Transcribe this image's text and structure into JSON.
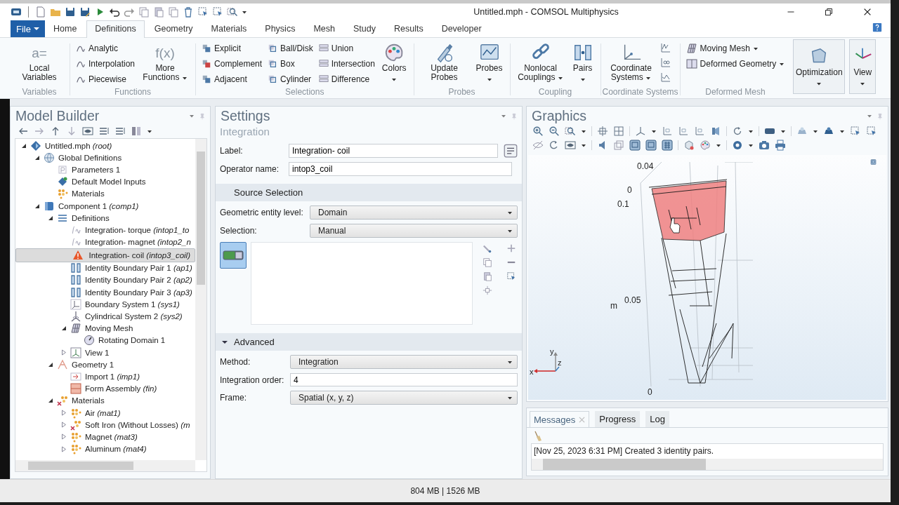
{
  "window": {
    "title": "Untitled.mph - COMSOL Multiphysics"
  },
  "file_button": {
    "label": "File"
  },
  "tabs": [
    {
      "label": "Home",
      "selected": false
    },
    {
      "label": "Definitions",
      "selected": true
    },
    {
      "label": "Geometry",
      "selected": false
    },
    {
      "label": "Materials",
      "selected": false
    },
    {
      "label": "Physics",
      "selected": false
    },
    {
      "label": "Mesh",
      "selected": false
    },
    {
      "label": "Study",
      "selected": false
    },
    {
      "label": "Results",
      "selected": false
    },
    {
      "label": "Developer",
      "selected": false
    }
  ],
  "ribbon": {
    "groups": [
      {
        "label": "Variables",
        "blocks": [
          {
            "kind": "large",
            "glyph": "a=",
            "label": "Local Variables"
          }
        ]
      },
      {
        "label": "Functions",
        "blocks": [
          {
            "kind": "stack",
            "items": [
              {
                "label": "Analytic"
              },
              {
                "label": "Interpolation"
              },
              {
                "label": "Piecewise"
              }
            ]
          },
          {
            "kind": "large",
            "glyph": "f(x)",
            "label": "More Functions",
            "dropdown": true
          }
        ]
      },
      {
        "label": "Selections",
        "blocks": [
          {
            "kind": "stack",
            "items": [
              {
                "label": "Explicit"
              },
              {
                "label": "Complement"
              },
              {
                "label": "Adjacent"
              }
            ]
          },
          {
            "kind": "stack",
            "items": [
              {
                "label": "Ball/Disk"
              },
              {
                "label": "Box"
              },
              {
                "label": "Cylinder"
              }
            ]
          },
          {
            "kind": "stack",
            "items": [
              {
                "label": "Union"
              },
              {
                "label": "Intersection"
              },
              {
                "label": "Difference"
              }
            ]
          },
          {
            "kind": "large",
            "label": "Colors",
            "dropdown": true
          }
        ]
      },
      {
        "label": "Probes",
        "blocks": [
          {
            "kind": "large",
            "label": "Update Probes"
          },
          {
            "kind": "large",
            "label": "Probes",
            "dropdown": true
          }
        ]
      },
      {
        "label": "Coupling",
        "blocks": [
          {
            "kind": "large",
            "label": "Nonlocal Couplings",
            "dropdown": true
          },
          {
            "kind": "large",
            "label": "Pairs",
            "dropdown": true
          }
        ]
      },
      {
        "label": "Coordinate Systems",
        "blocks": [
          {
            "kind": "large",
            "label": "Coordinate Systems",
            "dropdown": true
          },
          {
            "kind": "icons"
          }
        ]
      },
      {
        "label": "Deformed Mesh",
        "blocks": [
          {
            "kind": "stack",
            "items": [
              {
                "label": "Moving Mesh",
                "dropdown": true
              },
              {
                "label": "Deformed Geometry",
                "dropdown": true
              }
            ]
          }
        ]
      },
      {
        "blocks": [
          {
            "kind": "framed",
            "label": "Optimization",
            "dropdown": true
          },
          {
            "kind": "framed",
            "label": "View",
            "dropdown": true
          }
        ]
      }
    ]
  },
  "model_builder": {
    "title": "Model Builder",
    "tree": [
      {
        "label": "Untitled.mph  *(root)*",
        "kind": "root",
        "expanded": true,
        "selected": false,
        "children": [
          {
            "label": "Global Definitions",
            "kind": "globe",
            "expanded": true,
            "selected": false,
            "children": [
              {
                "label": "Parameters 1",
                "kind": "parameters",
                "selected": false
              },
              {
                "label": "Default Model Inputs",
                "kind": "inputs",
                "selected": false
              },
              {
                "label": "Materials",
                "kind": "materials",
                "selected": false
              }
            ]
          },
          {
            "label": "Component 1  *(comp1)*",
            "kind": "component",
            "expanded": true,
            "selected": false,
            "children": [
              {
                "label": "Definitions",
                "kind": "definitions",
                "expanded": true,
                "selected": false,
                "children": [
                  {
                    "label": "Integration- torque  *(intop1_to*",
                    "kind": "integration",
                    "selected": false
                  },
                  {
                    "label": "Integration- magnet  *(intop2_n*",
                    "kind": "integration",
                    "selected": false
                  },
                  {
                    "label": "Integration- coil  *(intop3_coil)*",
                    "kind": "warning",
                    "selected": true
                  },
                  {
                    "label": "Identity Boundary Pair 1  *(ap1)*",
                    "kind": "pair",
                    "selected": false
                  },
                  {
                    "label": "Identity Boundary Pair 2  *(ap2)*",
                    "kind": "pair",
                    "selected": false
                  },
                  {
                    "label": "Identity Boundary Pair 3  *(ap3)*",
                    "kind": "pair",
                    "selected": false
                  },
                  {
                    "label": "Boundary System 1  *(sys1)*",
                    "kind": "boundary-system",
                    "selected": false
                  },
                  {
                    "label": "Cylindrical System 2  *(sys2)*",
                    "kind": "cylindrical-system",
                    "selected": false
                  },
                  {
                    "label": "Moving Mesh",
                    "kind": "moving-mesh",
                    "expanded": true,
                    "selected": false,
                    "children": [
                      {
                        "label": "Rotating Domain 1",
                        "kind": "rotating",
                        "selected": false
                      }
                    ]
                  },
                  {
                    "label": "View 1",
                    "kind": "view",
                    "expanded": false,
                    "selected": false
                  }
                ]
              },
              {
                "label": "Geometry 1",
                "kind": "geometry",
                "expanded": true,
                "selected": false,
                "children": [
                  {
                    "label": "Import 1  *(imp1)*",
                    "kind": "import",
                    "selected": false
                  },
                  {
                    "label": "Form Assembly  *(fin)*",
                    "kind": "assembly",
                    "selected": false
                  }
                ]
              },
              {
                "label": "Materials",
                "kind": "material-list",
                "expanded": true,
                "selected": false,
                "children": [
                  {
                    "label": "Air  *(mat1)*",
                    "kind": "material",
                    "expanded": false,
                    "selected": false
                  },
                  {
                    "label": "Soft Iron (Without Losses)  *(m*",
                    "kind": "material-error",
                    "expanded": false,
                    "selected": false
                  },
                  {
                    "label": "Magnet  *(mat3)*",
                    "kind": "material",
                    "expanded": false,
                    "selected": false
                  },
                  {
                    "label": "Aluminum  *(mat4)*",
                    "kind": "material",
                    "expanded": false,
                    "selected": false
                  }
                ]
              }
            ]
          }
        ]
      }
    ]
  },
  "settings": {
    "title": "Settings",
    "subtitle": "Integration",
    "fields": [
      {
        "kind": "input-button",
        "label": "Label:",
        "value": "Integration- coil"
      },
      {
        "kind": "input",
        "label": "Operator name:",
        "value": "intop3_coil"
      }
    ],
    "sections": [
      {
        "title": "Source Selection",
        "rows": [
          {
            "kind": "select",
            "label": "Geometric entity level:",
            "value": "Domain"
          },
          {
            "kind": "select",
            "label": "Selection:",
            "value": "Manual"
          },
          {
            "kind": "selection-list",
            "active": true
          }
        ]
      },
      {
        "title": "Advanced",
        "expanded": true,
        "rows": [
          {
            "kind": "select",
            "label": "Method:",
            "value": "Integration"
          },
          {
            "kind": "input",
            "label": "Integration order:",
            "value": "4"
          },
          {
            "kind": "select",
            "label": "Frame:",
            "value": "Spatial  (x, y, z)"
          }
        ]
      }
    ]
  },
  "graphics": {
    "title": "Graphics",
    "axis_labels": [
      "0.04",
      "0",
      "0.1",
      "0.05",
      "m",
      "0"
    ],
    "triad": [
      "x",
      "y",
      "z"
    ]
  },
  "messages": {
    "tabs": [
      {
        "label": "Messages",
        "selected": true,
        "closable": true
      },
      {
        "label": "Progress",
        "selected": false
      },
      {
        "label": "Log",
        "selected": false
      }
    ],
    "lines": [
      "[Nov 25, 2023 6:31 PM] Created 3 identity pairs."
    ]
  },
  "status_bar": {
    "text": "804 MB | 1526 MB"
  }
}
